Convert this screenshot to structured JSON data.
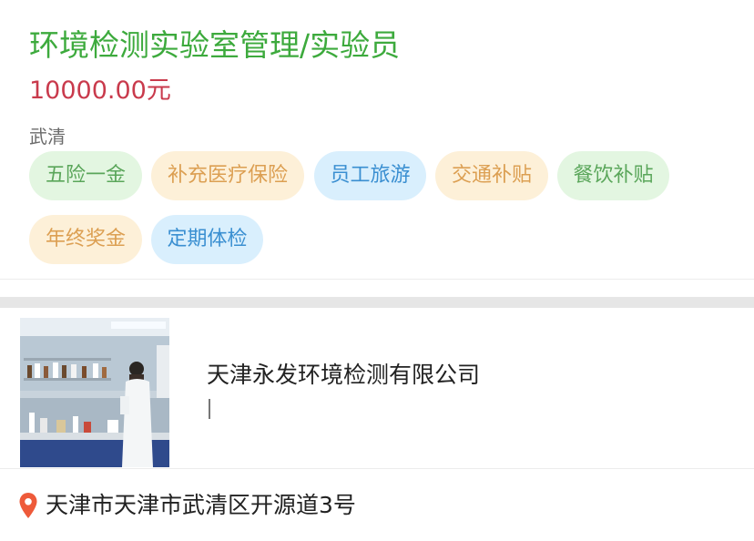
{
  "job": {
    "title": "环境检测实验室管理/实验员",
    "salary": "10000.00元",
    "location": "武清",
    "tags": [
      {
        "label": "五险一金",
        "color": "green"
      },
      {
        "label": "补充医疗保险",
        "color": "orange"
      },
      {
        "label": "员工旅游",
        "color": "blue"
      },
      {
        "label": "交通补贴",
        "color": "orange"
      },
      {
        "label": "餐饮补贴",
        "color": "green"
      },
      {
        "label": "年终奖金",
        "color": "orange"
      },
      {
        "label": "定期体检",
        "color": "blue"
      }
    ]
  },
  "company": {
    "name": "天津永发环境检测有限公司",
    "image": "laboratory-photo"
  },
  "address": {
    "icon": "location-pin-icon",
    "text": "天津市天津市武清区开源道3号"
  },
  "colors": {
    "title": "#3daa3d",
    "salary": "#c93a4c",
    "pin": "#ee5a3a"
  }
}
